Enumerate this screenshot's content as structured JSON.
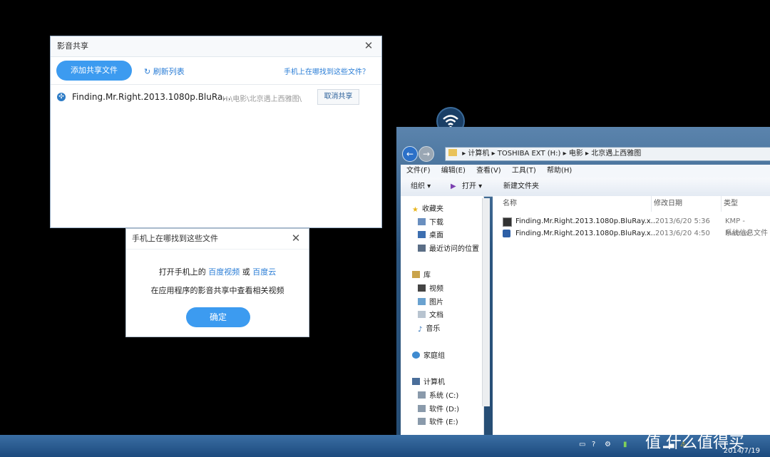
{
  "share_dialog": {
    "title": "影音共享",
    "add_button": "添加共享文件",
    "refresh": "刷新列表",
    "find_link": "手机上在哪找到这些文件？",
    "file": {
      "name": "Finding.Mr.Right.2013.1080p.BluRa...",
      "path": "H:\\电影\\北京遇上西雅图\\",
      "action": "取消共享"
    }
  },
  "find_dialog": {
    "title": "手机上在哪找到这些文件",
    "line1_prefix": "打开手机上的",
    "link1": "百度视频",
    "or": "或",
    "link2": "百度云",
    "line2": "在应用程序的影音共享中查看相关视频",
    "ok": "确定"
  },
  "explorer": {
    "address": [
      "计算机",
      "TOSHIBA EXT (H:)",
      "电影",
      "北京遇上西雅图"
    ],
    "menu": [
      "文件(F)",
      "编辑(E)",
      "查看(V)",
      "工具(T)",
      "帮助(H)"
    ],
    "commands": {
      "organize": "组织 ▾",
      "open": "打开 ▾",
      "new_folder": "新建文件夹"
    },
    "nav": {
      "favorites": "收藏夹",
      "downloads": "下载",
      "desktop": "桌面",
      "recent": "最近访问的位置",
      "libraries": "库",
      "videos": "视频",
      "pictures": "图片",
      "documents": "文档",
      "music": "音乐",
      "homegroup": "家庭组",
      "computer": "计算机",
      "drive_c": "系统 (C:)",
      "drive_d": "软件 (D:)",
      "drive_e": "软件 (E:)"
    },
    "columns": {
      "name": "名称",
      "date": "修改日期",
      "type": "类型"
    },
    "files": [
      {
        "name": "Finding.Mr.Right.2013.1080p.BluRay.x...",
        "date": "2013/6/20 5:36",
        "type": "KMP - Matros"
      },
      {
        "name": "Finding.Mr.Right.2013.1080p.BluRay.x...",
        "date": "2013/6/20 4:50",
        "type": "系统信息文件"
      }
    ]
  },
  "taskbar": {
    "date": "2014/7/19",
    "watermark": "值 什么值得买"
  }
}
